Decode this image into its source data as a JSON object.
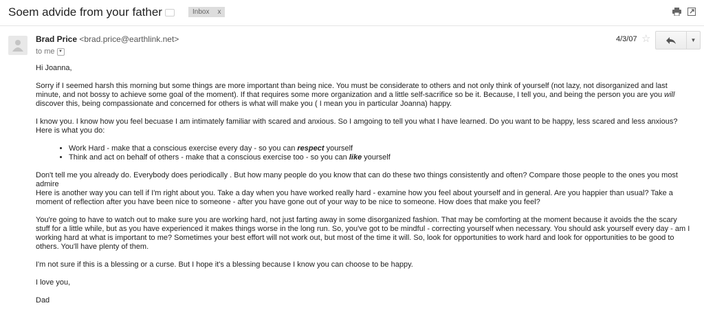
{
  "subject": "Soem advide from your father",
  "label_chip": {
    "text": "Inbox",
    "close": "x"
  },
  "sender": {
    "name": "Brad Price",
    "email": "<brad.price@earthlink.net>"
  },
  "to_line": "to me",
  "date": "4/3/07",
  "body": {
    "greeting": "Hi Joanna,",
    "p1": {
      "a": "Sorry if I seemed harsh this morning but some things are more important than being nice.   You must be considerate to others and not only think of yourself (not lazy, not disorganized and last minute, and not bossy to achieve some goal of the moment).  If that requires some more organization and a little self-sacrifice so be it.  Because, I tell you, and being the person you are you ",
      "em": "will",
      "b": " discover this, being compassionate and concerned for others is what will make you ( I mean you in particular Joanna) happy."
    },
    "p2": "I know you.  I know how you feel becuase I am intimately familiar with scared and anxious.  So I  amgoing to tell you what I have learned.   Do you want to be happy, less scared and less anxious?  Here is what you do:",
    "bullets": [
      {
        "a": "Work Hard - make that a conscious exercise every day  - so you can ",
        "em": "respect",
        "b": " yourself"
      },
      {
        "a": "Think and act on behalf of others - make that a conscious exercise too - so you can ",
        "em": "like",
        "b": " yourself"
      }
    ],
    "p3": "Don't tell me you already do.  Everybody does periodically .  But how many people do you know that can do these two things consistently and often?  Compare those people to the ones you most admire",
    "p4": "Here is another way you can tell if I'm right about you.  Take a day when you have worked really hard - examine how you feel about yourself and in general.  Are you happier than usual?   Take a moment of reflection after you have been nice to someone - after you have gone out of your way to be nice to someone.  How does that make you feel?",
    "p5": "You're going to have to watch out to make sure you are working hard, not just farting away in some disorganized fashion. That may be comforting at the moment because it avoids the the scary stuff for a little while, but as you have experienced it makes things worse in the long run.  So, you've got  to be mindful - correcting yourself when necessary.  You should ask yourself every day - am I working hard at what is important to me?   Sometimes your best effort will not work out, but most of the time it will.   So, look for opportunities to work hard and look for opportunities to be good to others.  You'll have plenty of them.",
    "p6": "I'm not sure if this is a blessing or a curse.  But I hope it's a blessing because I know you can choose to be happy.",
    "p7": "I love you,",
    "signature": "Dad"
  },
  "icons": {
    "label": "label-icon",
    "print": "print-icon",
    "popout": "new-window-icon",
    "avatar": "avatar-icon",
    "star": "star-icon",
    "reply": "reply-icon",
    "more": "more-options-icon"
  }
}
